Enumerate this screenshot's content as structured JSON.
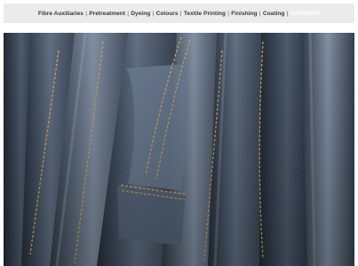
{
  "nav": {
    "items": [
      {
        "label": "Fibre Auxiliaries",
        "active": false
      },
      {
        "label": "Pretreatment",
        "active": false
      },
      {
        "label": "Dyeing",
        "active": false
      },
      {
        "label": "Colours",
        "active": false
      },
      {
        "label": "Textile Printing",
        "active": false
      },
      {
        "label": "Finishing",
        "active": false
      },
      {
        "label": "Coating",
        "active": false
      },
      {
        "label": "GARMENT",
        "active": true
      }
    ],
    "separator": "|"
  },
  "hero": {
    "subject": "stack of hanging denim jeans",
    "colors": {
      "denim_dark": "#2c3644",
      "denim_mid": "#56657a",
      "denim_light": "#8a98ab",
      "stitching": "#c9a267",
      "separator_red": "#c0282d",
      "nav_background": "#ebebeb"
    }
  }
}
